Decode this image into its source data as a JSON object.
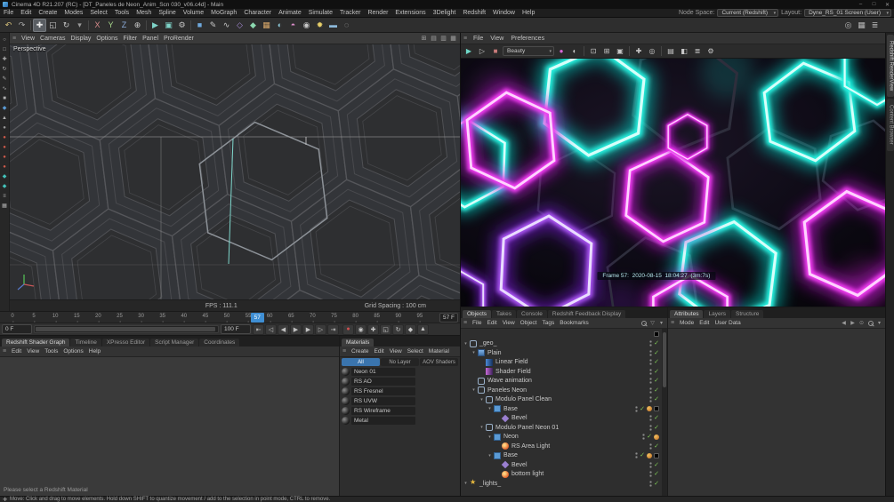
{
  "window": {
    "title": "Cinema 4D R21.207 (RC) - [DT_Paneles de Neon_Anim_Scn 030_v06.c4d] - Main",
    "minimize": "–",
    "maximize": "□",
    "close": "✕"
  },
  "menubar": {
    "items": [
      "File",
      "Edit",
      "Create",
      "Modes",
      "Select",
      "Tools",
      "Mesh",
      "Spline",
      "Volume",
      "MoGraph",
      "Character",
      "Animate",
      "Simulate",
      "Tracker",
      "Render",
      "Extensions",
      "3Delight",
      "Redshift",
      "Window",
      "Help"
    ],
    "node_space_label": "Node Space:",
    "node_space_value": "Current (Redshift)",
    "layout_label": "Layout:",
    "layout_value": "Dyne_RS_01 Screen (User)"
  },
  "toolbar": {
    "items": [
      {
        "name": "undo-icon",
        "glyph": "↶",
        "color": "#d8c27a"
      },
      {
        "name": "redo-icon",
        "glyph": "↷",
        "color": "#a8a8a8"
      },
      {
        "sep": true
      },
      {
        "name": "move-tool-icon",
        "glyph": "✚",
        "color": "#e8e8e8",
        "active": true
      },
      {
        "name": "scale-tool-icon",
        "glyph": "◱",
        "color": "#c8c8c8"
      },
      {
        "name": "rotate-tool-icon",
        "glyph": "↻",
        "color": "#c8c8c8"
      },
      {
        "name": "last-tool-icon",
        "glyph": "▾",
        "color": "#9a9a9a"
      },
      {
        "sep": true
      },
      {
        "name": "lock-x-axis-icon",
        "glyph": "X",
        "color": "#d98c8c"
      },
      {
        "name": "lock-y-axis-icon",
        "glyph": "Y",
        "color": "#a8d98c"
      },
      {
        "name": "lock-z-axis-icon",
        "glyph": "Z",
        "color": "#8cacd9"
      },
      {
        "name": "coordinate-system-icon",
        "glyph": "⊕",
        "color": "#c8c8c8"
      },
      {
        "sep": true
      },
      {
        "name": "render-view-icon",
        "glyph": "▶",
        "color": "#7fd3c8"
      },
      {
        "name": "render-picture-viewer-icon",
        "glyph": "▣",
        "color": "#7fd3c8"
      },
      {
        "name": "render-settings-icon",
        "glyph": "⚙",
        "color": "#c8c8c8"
      },
      {
        "sep": true
      },
      {
        "name": "primitive-cube-icon",
        "glyph": "■",
        "color": "#6fa8dc"
      },
      {
        "name": "spline-pen-icon",
        "glyph": "✎",
        "color": "#c8c8c8"
      },
      {
        "name": "spline-arc-icon",
        "glyph": "∿",
        "color": "#c8c8c8"
      },
      {
        "name": "subdivision-surface-icon",
        "glyph": "◇",
        "color": "#a98cd9"
      },
      {
        "name": "array-generator-icon",
        "glyph": "◆",
        "color": "#8cd9b0"
      },
      {
        "name": "volume-builder-icon",
        "glyph": "▦",
        "color": "#d9a86a"
      },
      {
        "name": "fields-icon",
        "glyph": "◐",
        "color": "#8cc8d9"
      },
      {
        "name": "deformer-icon",
        "glyph": "◓",
        "color": "#d98cc8"
      },
      {
        "name": "camera-icon",
        "glyph": "◉",
        "color": "#c8c8c8"
      },
      {
        "name": "light-icon",
        "glyph": "✹",
        "color": "#e8d06a"
      },
      {
        "name": "floor-icon",
        "glyph": "▬",
        "color": "#8cb8d9"
      },
      {
        "name": "sky-icon",
        "glyph": "◌",
        "color": "#c8c8c8"
      }
    ],
    "right_items": [
      {
        "name": "snap-toggle-icon",
        "glyph": "◎",
        "color": "#b8b8b8"
      },
      {
        "name": "workplane-icon",
        "glyph": "▦",
        "color": "#b8b8b8"
      },
      {
        "name": "layout-options-icon",
        "glyph": "≣",
        "color": "#b8b8b8"
      }
    ]
  },
  "left_toolbar": {
    "items": [
      {
        "name": "live-selection-icon",
        "glyph": "○",
        "color": "#b0b0b0"
      },
      {
        "name": "rectangle-selection-icon",
        "glyph": "□",
        "color": "#b0b0b0"
      },
      {
        "name": "move-icon",
        "glyph": "✚",
        "color": "#b0b0b0"
      },
      {
        "name": "rotate-icon",
        "glyph": "↻",
        "color": "#b0b0b0"
      },
      {
        "name": "pen-icon",
        "glyph": "✎",
        "color": "#b0b0b0"
      },
      {
        "name": "spline-icon",
        "glyph": "∿",
        "color": "#b0b0b0"
      },
      {
        "name": "cube-icon",
        "glyph": "■",
        "color": "#b0b0b0"
      },
      {
        "name": "modeling-icon",
        "glyph": "◆",
        "color": "#5b9bd5"
      },
      {
        "name": "polygon-icon",
        "glyph": "▲",
        "color": "#b0b0b0"
      },
      {
        "name": "sphere-icon",
        "glyph": "●",
        "color": "#9a9a9a"
      },
      {
        "name": "deformer-red-icon-1",
        "glyph": "●",
        "color": "#d05a4a"
      },
      {
        "name": "deformer-red-icon-2",
        "glyph": "●",
        "color": "#d05a4a"
      },
      {
        "name": "deformer-red-icon-3",
        "glyph": "●",
        "color": "#d05a4a"
      },
      {
        "name": "deformer-red-icon-4",
        "glyph": "●",
        "color": "#d05a4a"
      },
      {
        "name": "mograph-teal-icon-1",
        "glyph": "◆",
        "color": "#43c2ba"
      },
      {
        "name": "mograph-teal-icon-2",
        "glyph": "◆",
        "color": "#43c2ba"
      },
      {
        "name": "list-icon",
        "glyph": "≡",
        "color": "#b0b0b0"
      },
      {
        "name": "grid-icon",
        "glyph": "▦",
        "color": "#b0b0b0"
      }
    ]
  },
  "viewport": {
    "label": "Perspective",
    "menu": [
      "View",
      "Cameras",
      "Display",
      "Options",
      "Filter",
      "Panel",
      "ProRender"
    ],
    "view_icons": [
      {
        "name": "single-view-icon",
        "glyph": "⊞"
      },
      {
        "name": "top-view-icon",
        "glyph": "▤"
      },
      {
        "name": "right-view-icon",
        "glyph": "▥"
      },
      {
        "name": "all-views-icon",
        "glyph": "▦"
      }
    ],
    "fps": "FPS : 111.1",
    "grid_spacing": "Grid Spacing : 100 cm"
  },
  "renderview": {
    "menu": [
      "File",
      "View",
      "Preferences"
    ],
    "toolbar": [
      {
        "name": "render-start-icon",
        "glyph": "▶",
        "color": "#6fd8c8"
      },
      {
        "name": "ipr-render-icon",
        "glyph": "▷",
        "color": "#c8c8c8"
      },
      {
        "name": "stop-render-icon",
        "glyph": "■",
        "color": "#c87a7a"
      },
      {
        "dropdown": true,
        "name": "aov-select",
        "value": "Beauty"
      },
      {
        "name": "display-color-icon",
        "glyph": "●",
        "color": "#d867d8"
      },
      {
        "name": "clay-toggle-icon",
        "glyph": "◐",
        "color": "#c8c8c8"
      },
      {
        "sep": true
      },
      {
        "name": "region-render-icon",
        "glyph": "⊡",
        "color": "#c8c8c8"
      },
      {
        "name": "crop-icon",
        "glyph": "⊞",
        "color": "#c8c8c8"
      },
      {
        "name": "pixel-ratio-icon",
        "glyph": "▣",
        "color": "#c8c8c8"
      },
      {
        "sep": true
      },
      {
        "name": "pan-view-icon",
        "glyph": "✚",
        "color": "#c8c8c8"
      },
      {
        "name": "zoom-view-icon",
        "glyph": "◎",
        "color": "#c8c8c8"
      },
      {
        "sep": true
      },
      {
        "name": "snapshot-icon",
        "glyph": "▤",
        "color": "#c8c8c8"
      },
      {
        "name": "ab-compare-icon",
        "glyph": "◧",
        "color": "#c8c8c8"
      },
      {
        "name": "snapshot-history-icon",
        "glyph": "≣",
        "color": "#c8c8c8"
      },
      {
        "name": "renderview-options-icon",
        "glyph": "⚙",
        "color": "#c8c8c8"
      }
    ],
    "frame_info": "Frame 57:  2020-08-15  18:04:27  (3m:7s)",
    "vertical_tabs": [
      {
        "label": "Redshift RenderView",
        "active": true
      },
      {
        "label": "Content Browser",
        "active": false
      }
    ]
  },
  "timeline": {
    "ticks": [
      {
        "frame": 0,
        "label": "0"
      },
      {
        "frame": 5,
        "label": "5"
      },
      {
        "frame": 10,
        "label": "10"
      },
      {
        "frame": 15,
        "label": "15"
      },
      {
        "frame": 20,
        "label": "20"
      },
      {
        "frame": 25,
        "label": "25"
      },
      {
        "frame": 30,
        "label": "30"
      },
      {
        "frame": 35,
        "label": "35"
      },
      {
        "frame": 40,
        "label": "40"
      },
      {
        "frame": 45,
        "label": "45"
      },
      {
        "frame": 50,
        "label": "50"
      },
      {
        "frame": 55,
        "label": "55"
      },
      {
        "frame": 60,
        "label": "60"
      },
      {
        "frame": 65,
        "label": "65"
      },
      {
        "frame": 70,
        "label": "70"
      },
      {
        "frame": 75,
        "label": "75"
      },
      {
        "frame": 80,
        "label": "80"
      },
      {
        "frame": 85,
        "label": "85"
      },
      {
        "frame": 90,
        "label": "90"
      },
      {
        "frame": 95,
        "label": "95"
      }
    ],
    "current": {
      "frame": 57,
      "label": "57"
    },
    "current_field": "57 F"
  },
  "transport": {
    "start_field": "0 F",
    "end_field": "100 F",
    "buttons": [
      {
        "name": "goto-start-button",
        "glyph": "⇤"
      },
      {
        "name": "prev-key-button",
        "glyph": "◁"
      },
      {
        "name": "prev-frame-button",
        "glyph": "◀"
      },
      {
        "name": "play-button",
        "glyph": "▶"
      },
      {
        "name": "next-frame-button",
        "glyph": "▶"
      },
      {
        "name": "next-key-button",
        "glyph": "▷"
      },
      {
        "name": "goto-end-button",
        "glyph": "⇥"
      }
    ],
    "key_buttons": [
      {
        "name": "record-keyframe-button",
        "glyph": "●",
        "color": "#d05050"
      },
      {
        "name": "autokey-button",
        "glyph": "◉",
        "color": "#c8c8c8"
      },
      {
        "name": "keyframe-position-button",
        "glyph": "✚",
        "color": "#c8c8c8"
      },
      {
        "name": "keyframe-scale-button",
        "glyph": "◱",
        "color": "#c8c8c8"
      },
      {
        "name": "keyframe-rotation-button",
        "glyph": "↻",
        "color": "#c8c8c8"
      },
      {
        "name": "keyframe-parameter-button",
        "glyph": "◆",
        "color": "#c8c8c8"
      },
      {
        "name": "keyframe-pla-button",
        "glyph": "▲",
        "color": "#c8c8c8"
      }
    ]
  },
  "shader_graph": {
    "tabs": [
      {
        "label": "Redshift Shader Graph",
        "active": true
      },
      {
        "label": "Timeline",
        "active": false
      },
      {
        "label": "XPresso Editor",
        "active": false
      },
      {
        "label": "Script Manager",
        "active": false
      },
      {
        "label": "Coordinates",
        "active": false
      }
    ],
    "menu": [
      "Edit",
      "View",
      "Tools",
      "Options",
      "Help"
    ],
    "hint": "Please select a Redshift Material"
  },
  "materials": {
    "tab": "Materials",
    "menu": [
      "Create",
      "Edit",
      "View",
      "Select",
      "Material"
    ],
    "filters": [
      {
        "label": "All",
        "active": true
      },
      {
        "label": "No Layer",
        "active": false
      },
      {
        "label": "AOV Shaders",
        "active": false
      }
    ],
    "items": [
      "Neon 01",
      "RS AO",
      "RS Fresnel",
      "RS UVW",
      "RS Wireframe",
      "Metal"
    ]
  },
  "objects": {
    "tabs": [
      {
        "label": "Objects",
        "active": true
      },
      {
        "label": "Takes",
        "active": false
      },
      {
        "label": "Console",
        "active": false
      },
      {
        "label": "Redshift Feedback Display",
        "active": false
      }
    ],
    "menu": [
      "File",
      "Edit",
      "View",
      "Object",
      "Tags",
      "Bookmarks"
    ],
    "menu_icons": [
      {
        "name": "search-icon",
        "cls": "mag"
      },
      {
        "name": "filter-icon",
        "glyph": "▽"
      },
      {
        "name": "panel-options-icon",
        "glyph": "▾"
      }
    ],
    "tree": [
      {
        "label": "",
        "depth": 0,
        "icon": "none",
        "dots": false,
        "checks": 0,
        "tags": [
          "black"
        ]
      },
      {
        "label": "_geo_",
        "depth": 0,
        "icon": "null",
        "expand": true,
        "dots": true,
        "checks": 1
      },
      {
        "label": "Plain",
        "depth": 1,
        "icon": "plain",
        "expand": true,
        "dots": true,
        "checks": 1
      },
      {
        "label": "Linear Field",
        "depth": 2,
        "icon": "field",
        "dots": true,
        "checks": 1
      },
      {
        "label": "Shader Field",
        "depth": 2,
        "icon": "field2",
        "dots": true,
        "checks": 1
      },
      {
        "label": "Wave animation",
        "depth": 1,
        "icon": "null",
        "dots": true,
        "checks": 1
      },
      {
        "label": "Paneles Neon",
        "depth": 1,
        "icon": "null",
        "expand": true,
        "dots": true,
        "checks": 1
      },
      {
        "label": "Modulo Panel Clean",
        "depth": 2,
        "icon": "null",
        "expand": true,
        "dots": true,
        "checks": 1
      },
      {
        "label": "Base",
        "depth": 3,
        "icon": "cube",
        "expand": true,
        "dots": true,
        "checks": 1,
        "tags": [
          "orange",
          "black"
        ]
      },
      {
        "label": "Bevel",
        "depth": 4,
        "icon": "bevel",
        "dots": true,
        "checks": 1
      },
      {
        "label": "Modulo Panel Neon 01",
        "depth": 2,
        "icon": "null",
        "expand": true,
        "dots": true,
        "checks": 1
      },
      {
        "label": "Neon",
        "depth": 3,
        "icon": "cube",
        "expand": true,
        "dots": true,
        "checks": 1,
        "tags": [
          "orange"
        ]
      },
      {
        "label": "RS Area Light",
        "depth": 4,
        "icon": "light",
        "dots": true,
        "checks": 1
      },
      {
        "label": "Base",
        "depth": 3,
        "icon": "cube",
        "expand": true,
        "dots": true,
        "checks": 1,
        "tags": [
          "orange",
          "black"
        ]
      },
      {
        "label": "Bevel",
        "depth": 4,
        "icon": "bevel",
        "dots": true,
        "checks": 1
      },
      {
        "label": "bottom light",
        "depth": 4,
        "icon": "light",
        "dots": true,
        "checks": 1
      },
      {
        "label": "_lights_",
        "depth": 0,
        "icon": "star",
        "expand": true,
        "dots": true,
        "checks": 1
      }
    ]
  },
  "attributes": {
    "tabs": [
      {
        "label": "Attributes",
        "active": true
      },
      {
        "label": "Layers",
        "active": false
      },
      {
        "label": "Structure",
        "active": false
      }
    ],
    "menu": [
      "Mode",
      "Edit",
      "User Data"
    ],
    "menu_icons": [
      {
        "name": "nav-back-icon",
        "glyph": "◀"
      },
      {
        "name": "nav-forward-icon",
        "glyph": "▶"
      },
      {
        "name": "lock-icon",
        "glyph": "⊙"
      },
      {
        "name": "search-icon",
        "cls": "mag"
      },
      {
        "name": "panel-options-icon",
        "glyph": "▾"
      }
    ]
  },
  "statusbar": {
    "text": "Move: Click and drag to move elements. Hold down SHIFT to quantize movement / add to the selection in point mode, CTRL to remove."
  }
}
